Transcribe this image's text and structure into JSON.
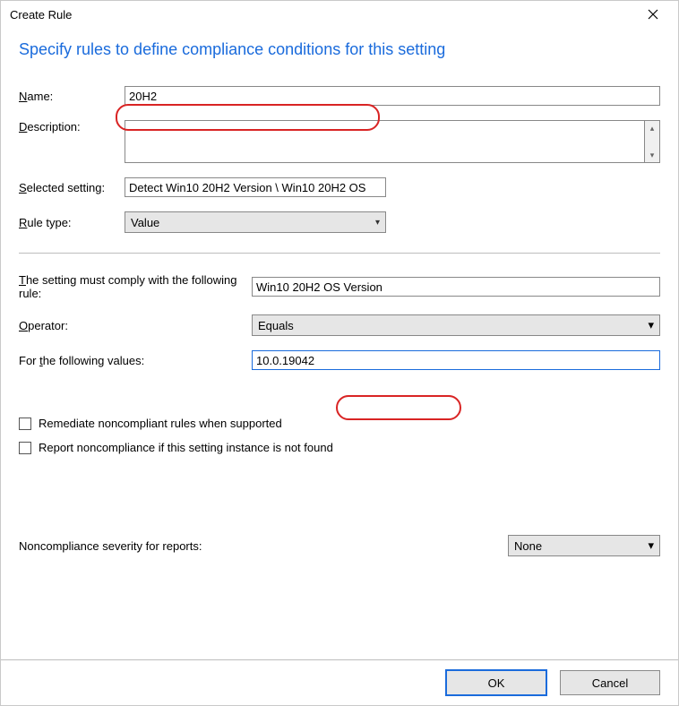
{
  "title": "Create Rule",
  "heading": "Specify rules to define compliance conditions for this setting",
  "labels": {
    "name": "Name:",
    "description": "Description:",
    "selected_setting": "Selected setting:",
    "rule_type": "Rule type:",
    "comply_text": "The setting must comply with the following rule:",
    "operator": "Operator:",
    "values": "For the following values:",
    "remediate": "Remediate noncompliant rules when supported",
    "report_notfound": "Report noncompliance if this setting instance is not found",
    "noncompliance_severity": "Noncompliance severity for reports:"
  },
  "fields": {
    "name": "20H2",
    "description": "",
    "selected_setting": "Detect Win10 20H2 Version \\ Win10 20H2 OS",
    "rule_type": "Value",
    "rule_display": "Win10 20H2 OS Version",
    "operator": "Equals",
    "values": "10.0.19042",
    "remediate_checked": false,
    "report_notfound_checked": false,
    "severity": "None"
  },
  "buttons": {
    "ok": "OK",
    "cancel": "Cancel"
  }
}
